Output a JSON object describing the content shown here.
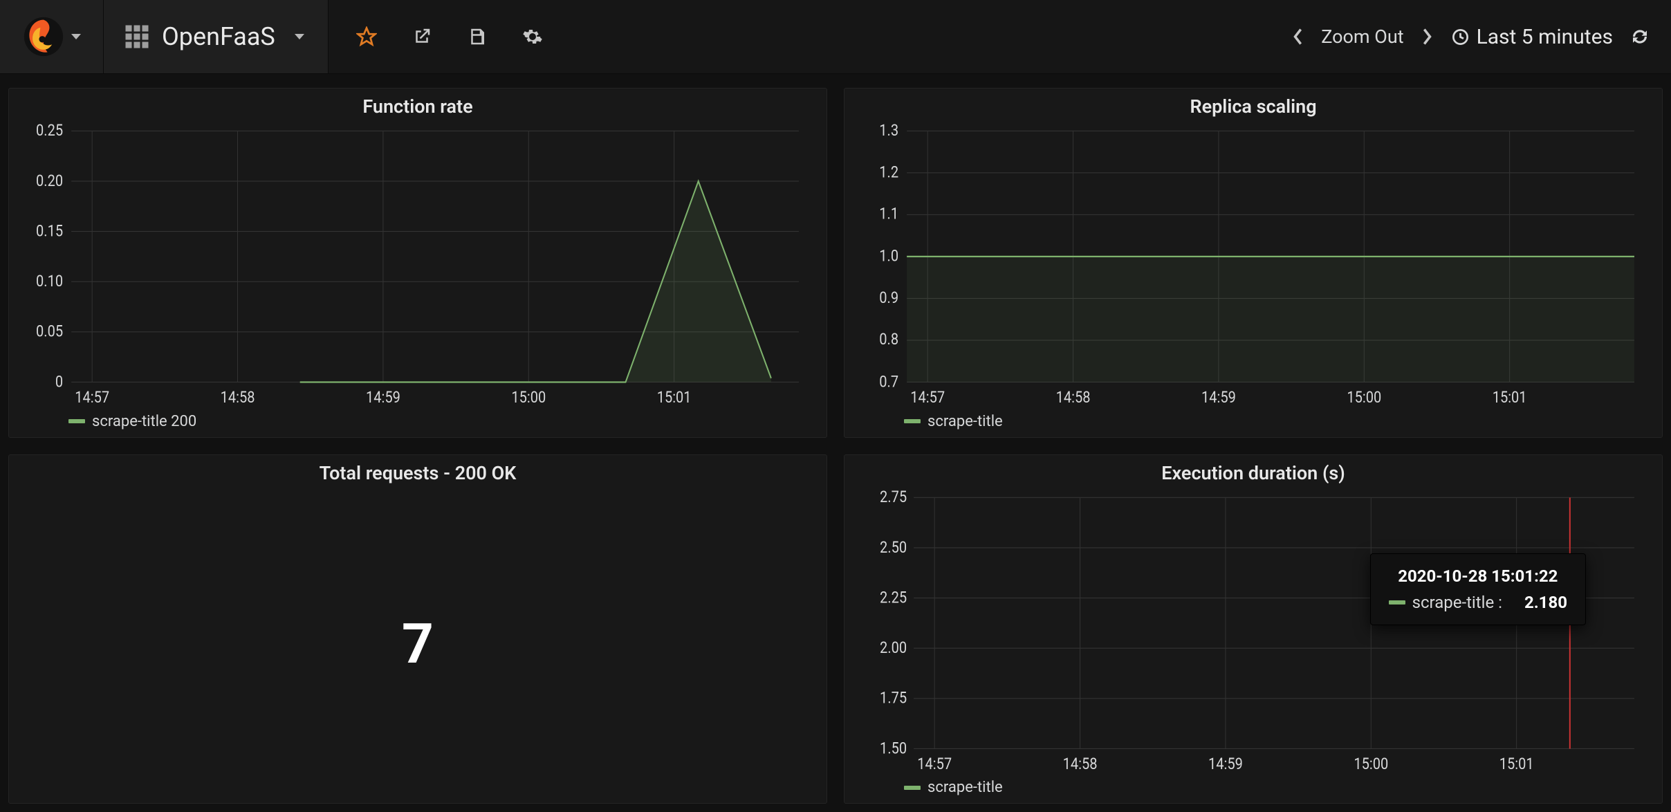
{
  "header": {
    "dashboard_title": "OpenFaaS",
    "zoom_out_label": "Zoom Out",
    "time_range_label": "Last 5 minutes"
  },
  "panels": {
    "function_rate": {
      "title": "Function rate",
      "legend": "scrape-title 200"
    },
    "replica_scaling": {
      "title": "Replica scaling",
      "legend": "scrape-title"
    },
    "total_requests": {
      "title": "Total requests - 200 OK",
      "value": "7"
    },
    "execution_duration": {
      "title": "Execution duration (s)",
      "legend": "scrape-title",
      "tooltip_time": "2020-10-28 15:01:22",
      "tooltip_series": "scrape-title :",
      "tooltip_value": "2.180"
    }
  },
  "chart_data": [
    {
      "panel": "function_rate",
      "type": "area",
      "title": "Function rate",
      "x_ticks": [
        "14:57",
        "14:58",
        "14:59",
        "15:00",
        "15:01"
      ],
      "ylim": [
        0,
        0.25
      ],
      "y_ticks": [
        0,
        0.05,
        0.1,
        0.15,
        0.2,
        0.25
      ],
      "series": [
        {
          "name": "scrape-title 200",
          "x": [
            "14:58:00",
            "15:00:40",
            "15:01:10",
            "15:01:40"
          ],
          "values": [
            0,
            0,
            0.2,
            0.01
          ]
        }
      ]
    },
    {
      "panel": "replica_scaling",
      "type": "line",
      "title": "Replica scaling",
      "x_ticks": [
        "14:57",
        "14:58",
        "14:59",
        "15:00",
        "15:01"
      ],
      "ylim": [
        0.7,
        1.3
      ],
      "y_ticks": [
        0.7,
        0.8,
        0.9,
        1.0,
        1.1,
        1.2,
        1.3
      ],
      "series": [
        {
          "name": "scrape-title",
          "values_constant": 1.0
        }
      ]
    },
    {
      "panel": "execution_duration",
      "type": "line",
      "title": "Execution duration (s)",
      "x_ticks": [
        "14:57",
        "14:58",
        "14:59",
        "15:00",
        "15:01"
      ],
      "ylim": [
        1.5,
        2.75
      ],
      "y_ticks": [
        1.5,
        1.75,
        2.0,
        2.25,
        2.5,
        2.75
      ],
      "crosshair_x": "15:01:22",
      "series": [
        {
          "name": "scrape-title",
          "x": [
            "15:01:22"
          ],
          "values": [
            2.18
          ]
        }
      ]
    }
  ]
}
